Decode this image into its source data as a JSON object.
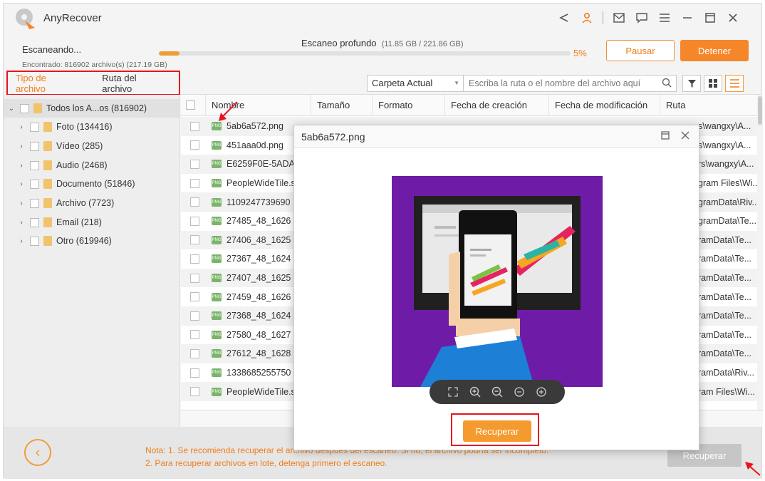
{
  "app": {
    "title": "AnyRecover"
  },
  "scan": {
    "status": "Escaneando...",
    "found": "Encontrado: 816902 archivo(s) (217.19 GB)",
    "mode": "Escaneo profundo",
    "size": "(11.85 GB / 221.86 GB)",
    "percent_label": "5%",
    "progress": 0.05,
    "pause_label": "Pausar",
    "stop_label": "Detener"
  },
  "tabs": {
    "file_type": "Tipo de archivo",
    "file_path": "Ruta del archivo"
  },
  "toolbar": {
    "folder_select": "Carpeta Actual",
    "path_placeholder": "Escriba la ruta o el nombre del archivo aquí"
  },
  "tree": {
    "root": "Todos los A...os (816902)",
    "items": [
      {
        "label": "Foto (134416)"
      },
      {
        "label": "Vídeo (285)"
      },
      {
        "label": "Audio (2468)"
      },
      {
        "label": "Documento (51846)"
      },
      {
        "label": "Archivo (7723)"
      },
      {
        "label": "Email (218)"
      },
      {
        "label": "Otro (619946)"
      }
    ]
  },
  "table": {
    "columns": [
      "Nombre",
      "Tamaño",
      "Formato",
      "Fecha de creación",
      "Fecha de modificación",
      "Ruta"
    ],
    "rows": [
      {
        "name": "5ab6a572.png",
        "path": "s\\wangxy\\A..."
      },
      {
        "name": "451aaa0d.png",
        "path": "s\\wangxy\\A..."
      },
      {
        "name": "E6259F0E-5ADA",
        "path": "rs\\wangxy\\A..."
      },
      {
        "name": "PeopleWideTile.s",
        "path": "gram Files\\Wi..."
      },
      {
        "name": "1109247739690",
        "path": "gramData\\Riv..."
      },
      {
        "name": "27485_48_1626",
        "path": "gramData\\Te..."
      },
      {
        "name": "27406_48_1625",
        "path": "ramData\\Te..."
      },
      {
        "name": "27367_48_1624",
        "path": "ramData\\Te..."
      },
      {
        "name": "27407_48_1625",
        "path": "ramData\\Te..."
      },
      {
        "name": "27459_48_1626",
        "path": "ramData\\Te..."
      },
      {
        "name": "27368_48_1624",
        "path": "ramData\\Te..."
      },
      {
        "name": "27580_48_1627",
        "path": "ramData\\Te..."
      },
      {
        "name": "27612_48_1628",
        "path": "ramData\\Te..."
      },
      {
        "name": "1338685255750",
        "path": "ramData\\Riv..."
      },
      {
        "name": "PeopleWideTile.s",
        "path": "ram Files\\Wi..."
      }
    ]
  },
  "footer": {
    "note_line1": "Nota: 1. Se recomienda recuperar el archivo después del escaneo. Si no, el archivo podría ser incompleto.",
    "note_line2": "2. Para recuperar archivos en lote, detenga primero el escaneo.",
    "recover_label": "Recuperar"
  },
  "modal": {
    "title": "5ab6a572.png",
    "recover_label": "Recuperar"
  },
  "colors": {
    "accent": "#f5872a",
    "highlight": "#e5141c",
    "preview_bg": "#6e1ca7"
  }
}
